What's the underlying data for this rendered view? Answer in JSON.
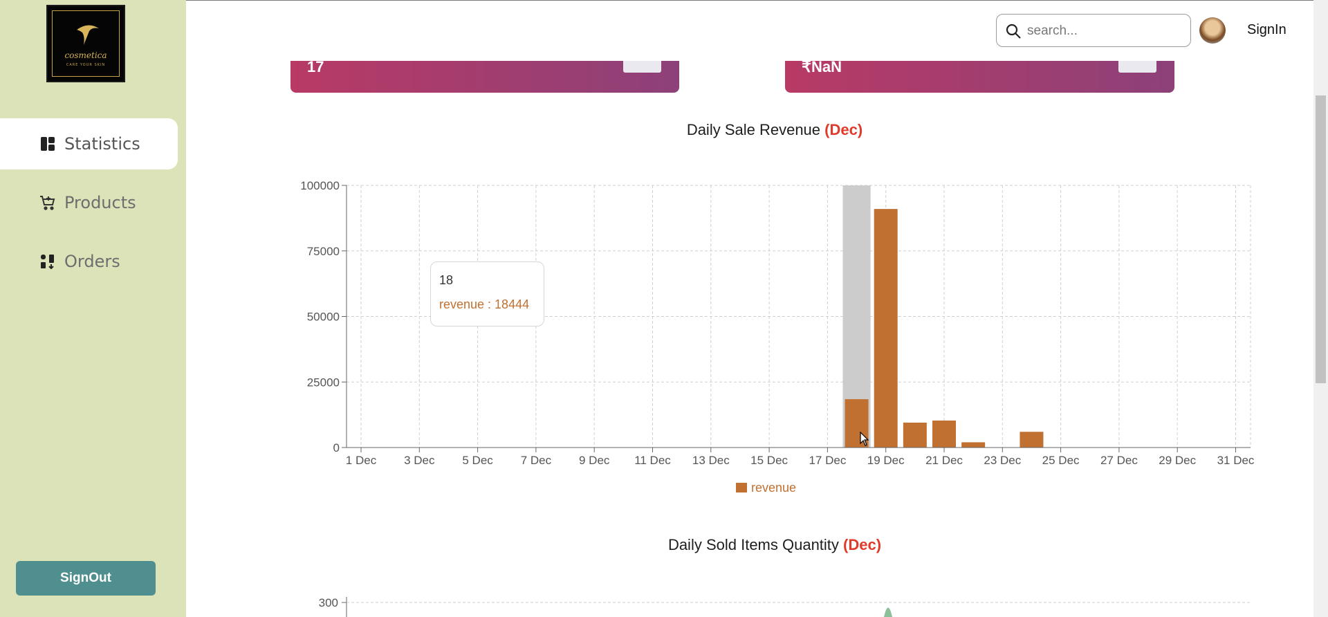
{
  "sidebar": {
    "logo": {
      "brand": "cosmetica",
      "tagline": "CARE YOUR SKIN"
    },
    "items": [
      {
        "label": "Statistics",
        "icon": "dashboard-icon",
        "active": true
      },
      {
        "label": "Products",
        "icon": "cart-icon",
        "active": false
      },
      {
        "label": "Orders",
        "icon": "orders-icon",
        "active": false
      }
    ],
    "signout_label": "SignOut"
  },
  "header": {
    "search_placeholder": "search...",
    "signin_label": "SignIn"
  },
  "cards": [
    {
      "value": "17"
    },
    {
      "value": "₹NaN"
    }
  ],
  "revenue_chart": {
    "title": "Daily Sale Revenue",
    "month": "(Dec)"
  },
  "quantity_chart": {
    "title": "Daily Sold Items Quantity",
    "month": "(Dec)",
    "y_tick_top": "300"
  },
  "tooltip": {
    "day": "18",
    "label": "revenue : 18444"
  },
  "colors": {
    "bar": "#c07030",
    "highlight": "#cccccc",
    "sidebar": "#dce3b9",
    "accent_month": "#e03a2b"
  },
  "chart_data": [
    {
      "type": "bar",
      "title": "Daily Sale Revenue (Dec)",
      "x": [
        1,
        2,
        3,
        4,
        5,
        6,
        7,
        8,
        9,
        10,
        11,
        12,
        13,
        14,
        15,
        16,
        17,
        18,
        19,
        20,
        21,
        22,
        23,
        24,
        25,
        26,
        27,
        28,
        29,
        30,
        31
      ],
      "x_tick_labels": [
        "1 Dec",
        "3 Dec",
        "5 Dec",
        "7 Dec",
        "9 Dec",
        "11 Dec",
        "13 Dec",
        "15 Dec",
        "17 Dec",
        "19 Dec",
        "21 Dec",
        "23 Dec",
        "25 Dec",
        "27 Dec",
        "29 Dec",
        "31 Dec"
      ],
      "series": [
        {
          "name": "revenue",
          "values": [
            0,
            0,
            0,
            0,
            0,
            0,
            0,
            0,
            0,
            0,
            0,
            0,
            0,
            0,
            0,
            0,
            0,
            18444,
            91000,
            9500,
            10300,
            2000,
            0,
            6000,
            0,
            0,
            0,
            0,
            0,
            0,
            0
          ]
        }
      ],
      "y_ticks": [
        0,
        25000,
        50000,
        75000,
        100000
      ],
      "ylim": [
        0,
        100000
      ],
      "highlighted_x": 18,
      "grid": true,
      "legend": "bottom"
    }
  ]
}
